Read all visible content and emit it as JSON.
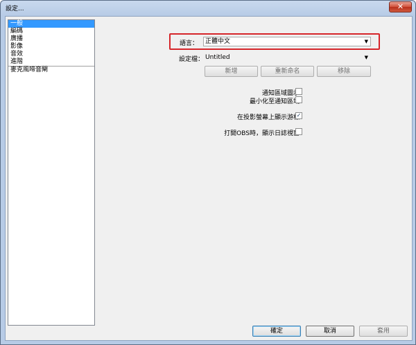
{
  "window": {
    "title": "設定..."
  },
  "sidebar": {
    "items": [
      {
        "label": "一般",
        "selected": true
      },
      {
        "label": "編碼"
      },
      {
        "label": "廣播"
      },
      {
        "label": "影像"
      },
      {
        "label": "音效"
      },
      {
        "label": "進階"
      },
      {
        "label": "麥克風啼音閘"
      }
    ]
  },
  "general": {
    "language_label": "語言：",
    "language_value": "正體中文",
    "profile_label": "設定檔：",
    "profile_value": "Untitled",
    "add_button": "新增",
    "rename_button": "重新命名",
    "remove_button": "移除",
    "checkboxes": [
      {
        "label": "通知區域圖示",
        "checked": false
      },
      {
        "label": "最小化至通知區域",
        "checked": false
      },
      {
        "label": "在投影螢幕上顯示游標",
        "checked": true
      },
      {
        "label": "打開OBS時，顯示日誌視窗",
        "checked": false
      }
    ]
  },
  "footer": {
    "ok_button": "確定",
    "cancel_button": "取消",
    "apply_button": "套用"
  },
  "colors": {
    "highlight": "#d6252a",
    "selection": "#3399ff"
  }
}
